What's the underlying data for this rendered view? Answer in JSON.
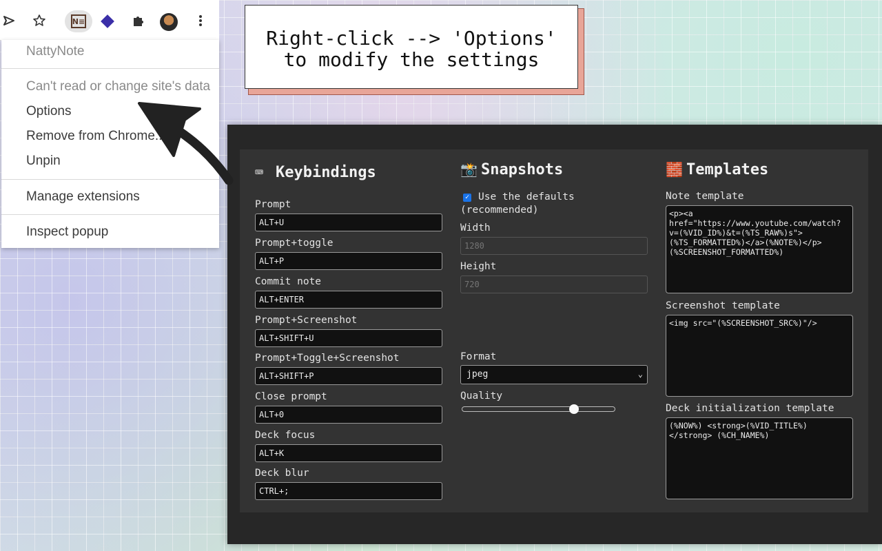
{
  "callout": {
    "line1": "Right-click --> 'Options'",
    "line2": "to modify the settings"
  },
  "browser": {
    "toolbar_icons": [
      "play-arrow-icon",
      "star-icon",
      "nattynote-extension-icon",
      "diamond-extension-icon",
      "puzzle-icon",
      "profile-avatar",
      "kebab-menu-icon"
    ],
    "extension_logo_text": "N≡",
    "context_menu": {
      "title": "NattyNote",
      "permission": "Can't read or change site's data",
      "options": "Options",
      "remove": "Remove from Chrome...",
      "unpin": "Unpin",
      "manage": "Manage extensions",
      "inspect": "Inspect popup"
    }
  },
  "options": {
    "keybindings": {
      "icon": "⌨",
      "title": "Keybindings",
      "items": [
        {
          "label": "Prompt",
          "value": "ALT+U"
        },
        {
          "label": "Prompt+toggle",
          "value": "ALT+P"
        },
        {
          "label": "Commit note",
          "value": "ALT+ENTER"
        },
        {
          "label": "Prompt+Screenshot",
          "value": "ALT+SHIFT+U"
        },
        {
          "label": "Prompt+Toggle+Screenshot",
          "value": "ALT+SHIFT+P"
        },
        {
          "label": "Close prompt",
          "value": "ALT+0"
        },
        {
          "label": "Deck focus",
          "value": "ALT+K"
        },
        {
          "label": "Deck blur",
          "value": "CTRL+;"
        }
      ]
    },
    "snapshots": {
      "icon": "📸",
      "title": "Snapshots",
      "use_defaults_label": "Use the defaults",
      "use_defaults_sub": "(recommended)",
      "use_defaults_checked": true,
      "width_label": "Width",
      "width_placeholder": "1280",
      "height_label": "Height",
      "height_placeholder": "720",
      "format_label": "Format",
      "format_value": "jpeg",
      "quality_label": "Quality",
      "quality_value": 0.73
    },
    "templates": {
      "icon": "🧱",
      "title": "Templates",
      "note_label": "Note template",
      "note_value": "<p><a href=\"https://www.youtube.com/watch?v=(%VID_ID%)&t=(%TS_RAW%)s\">(%TS_FORMATTED%)</a>(%NOTE%)</p>(%SCREENSHOT_FORMATTED%)",
      "screenshot_label": "Screenshot template",
      "screenshot_value": "<img src=\"(%SCREENSHOT_SRC%)\"/>",
      "deck_label": "Deck initialization template",
      "deck_value": "(%NOW%) <strong>(%VID_TITLE%)</strong> (%CH_NAME%)"
    }
  }
}
